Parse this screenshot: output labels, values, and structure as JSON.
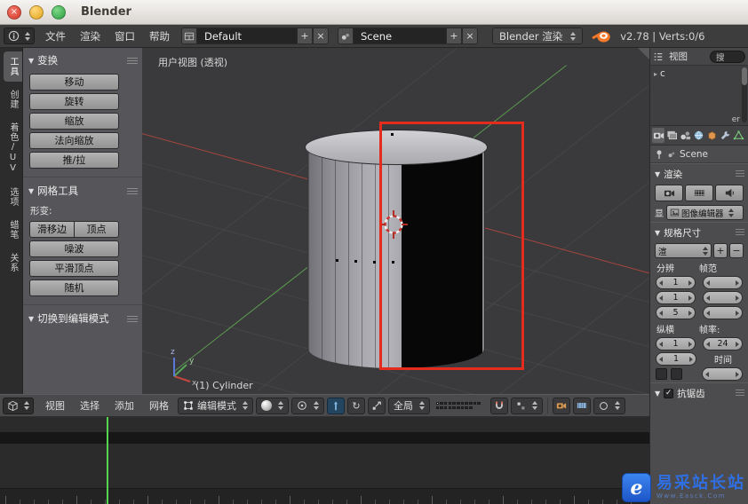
{
  "window": {
    "title": "Blender"
  },
  "infobar": {
    "menus": [
      "文件",
      "渲染",
      "窗口",
      "帮助"
    ],
    "layout_value": "Default",
    "scene_value": "Scene",
    "engine_value": "Blender 渲染",
    "stats": "v2.78 | Verts:0/6"
  },
  "toolshelf": {
    "tabs": [
      {
        "label": "工具",
        "active": true
      },
      {
        "label": "创建"
      },
      {
        "label": "着色/UV"
      },
      {
        "label": "选项"
      },
      {
        "label": "蜡笔"
      },
      {
        "label": "关系"
      }
    ],
    "transform_panel": {
      "title": "变换",
      "buttons": [
        "移动",
        "旋转",
        "缩放",
        "法向缩放",
        "推/拉"
      ]
    },
    "meshtools_panel": {
      "title": "网格工具",
      "deform_label": "形变:",
      "row1": [
        "滑移边",
        "顶点"
      ],
      "row2": "噪波",
      "row3": "平滑顶点",
      "row4": "随机"
    },
    "bottom_panel_title": "切换到编辑模式"
  },
  "viewport": {
    "view_label": "用户视图 (透视)",
    "object_label": "(1) Cylinder",
    "axis_x": "x",
    "axis_y": "y",
    "axis_z": "z"
  },
  "outliner": {
    "menu": "视图",
    "search_placeholder": "搜",
    "item": "c",
    "clipped_text": "er"
  },
  "properties": {
    "breadcrumb": "Scene",
    "render_panel": {
      "title": "渲染",
      "display_label": "显",
      "display_value": "图像编辑器"
    },
    "dimensions_panel": {
      "title": "规格尺寸",
      "preset_value": "渲",
      "resolution_label": "分辨",
      "frame_label": "帧范",
      "res_x": "1",
      "res_y": "1",
      "res_pct": "5",
      "aspect_label": "纵横",
      "aspect_x": "1",
      "aspect_y": "1",
      "fps_label": "帧率:",
      "fps_value": "24",
      "time_label": "时间"
    },
    "aa_panel": {
      "title": "抗锯齿",
      "checked": "✓"
    }
  },
  "view3d_header": {
    "menus": [
      "视图",
      "选择",
      "添加",
      "网格"
    ],
    "mode_value": "编辑模式",
    "orientation_value": "全局"
  },
  "watermark": {
    "title": "易采站长站",
    "subtitle": "Www.Easck.Com",
    "logo_letter": "e"
  },
  "colors": {
    "selection_annotation_red": "#e42b1e",
    "playhead_green": "#57d44f",
    "watermark_blue": "#2f6fe4"
  }
}
